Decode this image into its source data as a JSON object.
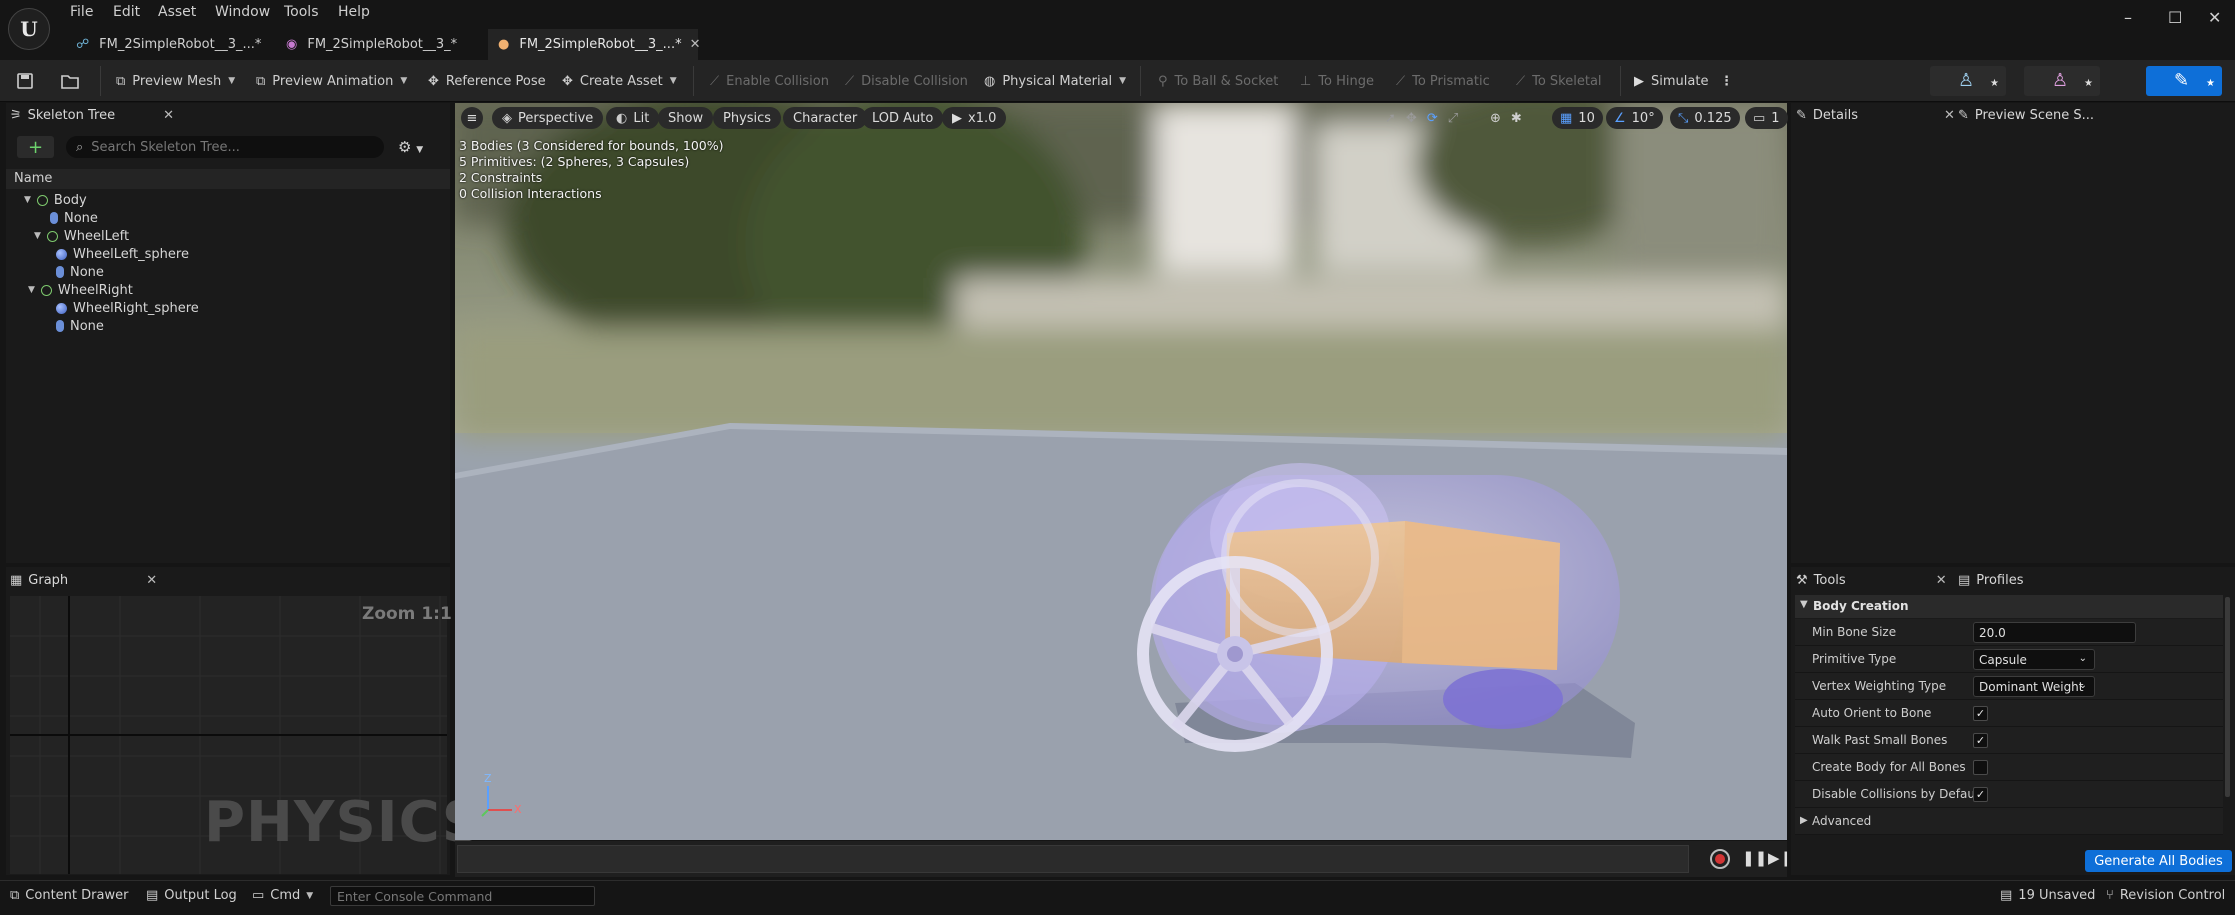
{
  "menu": [
    "File",
    "Edit",
    "Asset",
    "Window",
    "Tools",
    "Help"
  ],
  "tabs": [
    {
      "label": "FM_2SimpleRobot__3_...*"
    },
    {
      "label": "FM_2SimpleRobot__3_*"
    },
    {
      "label": "FM_2SimpleRobot__3_...*"
    }
  ],
  "toolbar": {
    "preview_mesh": "Preview Mesh",
    "preview_animation": "Preview Animation",
    "reference_pose": "Reference Pose",
    "create_asset": "Create Asset",
    "enable_collision": "Enable Collision",
    "disable_collision": "Disable Collision",
    "physical_material": "Physical Material",
    "to_ball_socket": "To Ball & Socket",
    "to_hinge": "To Hinge",
    "to_prismatic": "To Prismatic",
    "to_skeletal": "To Skeletal",
    "simulate": "Simulate"
  },
  "skeleton_tree": {
    "tab": "Skeleton Tree",
    "search_placeholder": "Search Skeleton Tree...",
    "column": "Name",
    "rows": [
      {
        "label": "Body",
        "kind": "bone"
      },
      {
        "label": "None",
        "kind": "body"
      },
      {
        "label": "WheelLeft",
        "kind": "bone"
      },
      {
        "label": "WheelLeft_sphere",
        "kind": "sphere"
      },
      {
        "label": "None",
        "kind": "body"
      },
      {
        "label": "WheelRight",
        "kind": "bone"
      },
      {
        "label": "WheelRight_sphere",
        "kind": "sphere"
      },
      {
        "label": "None",
        "kind": "body"
      }
    ]
  },
  "graph": {
    "tab": "Graph",
    "zoom": "Zoom 1:1",
    "watermark": "PHYSICS"
  },
  "viewport": {
    "perspective": "Perspective",
    "lit": "Lit",
    "show": "Show",
    "physics": "Physics",
    "character": "Character",
    "lod": "LOD Auto",
    "speed": "x1.0",
    "grid_snap": "10",
    "rot_snap": "10°",
    "scale_snap": "0.125",
    "camera_speed": "1",
    "stats": [
      "3 Bodies (3 Considered for bounds, 100%)",
      "5 Primitives: (2 Spheres, 3 Capsules)",
      "2 Constraints",
      "0 Collision Interactions"
    ],
    "axis_z": "Z",
    "axis_x": "X"
  },
  "details": {
    "tab": "Details",
    "preview_tab": "Preview Scene S..."
  },
  "tools": {
    "tab": "Tools",
    "profiles_tab": "Profiles",
    "section": "Body Creation",
    "min_bone_size_label": "Min Bone Size",
    "min_bone_size": "20.0",
    "primitive_type_label": "Primitive Type",
    "primitive_type": "Capsule",
    "vertex_weighting_label": "Vertex Weighting Type",
    "vertex_weighting": "Dominant Weight",
    "auto_orient_label": "Auto Orient to Bone",
    "auto_orient": true,
    "walk_past_label": "Walk Past Small Bones",
    "walk_past": true,
    "create_body_label": "Create Body for All Bones",
    "create_body": false,
    "disable_collisions_label": "Disable Collisions by Default",
    "disable_collisions": true,
    "advanced": "Advanced",
    "generate_button": "Generate All Bodies"
  },
  "statusbar": {
    "content_drawer": "Content Drawer",
    "output_log": "Output Log",
    "cmd": "Cmd",
    "console_placeholder": "Enter Console Command",
    "unsaved": "19 Unsaved",
    "revision": "Revision Control"
  },
  "colors": {
    "accent_blue": "#0e6fd8",
    "bg_dark": "#151515",
    "panel": "#1a1a1a"
  }
}
